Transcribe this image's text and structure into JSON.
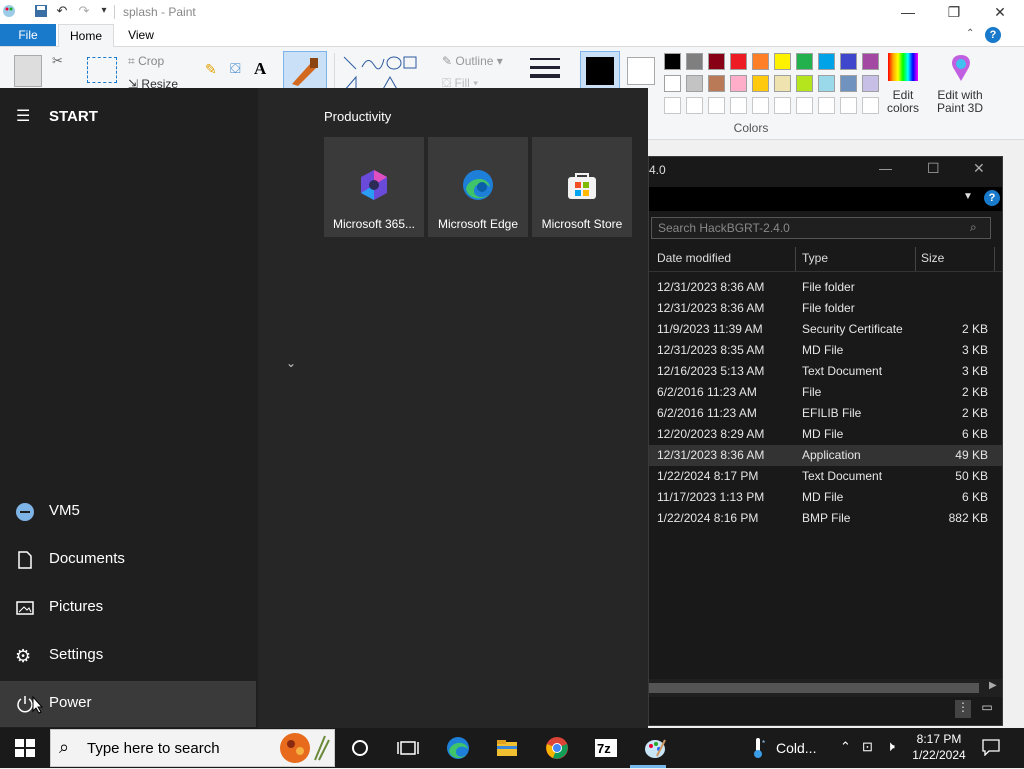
{
  "paint": {
    "title": "splash - Paint",
    "tabs": [
      "File",
      "Home",
      "View"
    ],
    "tools": {
      "crop": "Crop",
      "resize": "Resize",
      "outline": "Outline",
      "fill": "Fill",
      "text_tool": "A"
    },
    "colors_group_label": "Colors",
    "edit_colors": "Edit colors",
    "edit_with_3d": "Edit with Paint 3D",
    "palette_row1": [
      "#000000",
      "#7f7f7f",
      "#880015",
      "#ed1c24",
      "#ff7f27",
      "#fff200",
      "#22b14c",
      "#00a2e8",
      "#3f48cc",
      "#a349a4"
    ],
    "palette_row2": [
      "#ffffff",
      "#c3c3c3",
      "#b97a57",
      "#ffaec9",
      "#ffc90e",
      "#efe4b0",
      "#b5e61d",
      "#99d9ea",
      "#7092be",
      "#c8bfe7"
    ]
  },
  "explorer": {
    "title_fragment": "4.0",
    "search_placeholder": "Search HackBGRT-2.4.0",
    "columns": [
      "Date modified",
      "Type",
      "Size"
    ],
    "rows": [
      {
        "date": "12/31/2023 8:36 AM",
        "type": "File folder",
        "size": ""
      },
      {
        "date": "12/31/2023 8:36 AM",
        "type": "File folder",
        "size": ""
      },
      {
        "date": "11/9/2023 11:39 AM",
        "type": "Security Certificate",
        "size": "2 KB"
      },
      {
        "date": "12/31/2023 8:35 AM",
        "type": "MD File",
        "size": "3 KB"
      },
      {
        "date": "12/16/2023 5:13 AM",
        "type": "Text Document",
        "size": "3 KB"
      },
      {
        "date": "6/2/2016 11:23 AM",
        "type": "File",
        "size": "2 KB"
      },
      {
        "date": "6/2/2016 11:23 AM",
        "type": "EFILIB File",
        "size": "2 KB"
      },
      {
        "date": "12/20/2023 8:29 AM",
        "type": "MD File",
        "size": "6 KB"
      },
      {
        "date": "12/31/2023 8:36 AM",
        "type": "Application",
        "size": "49 KB"
      },
      {
        "date": "1/22/2024 8:17 PM",
        "type": "Text Document",
        "size": "50 KB"
      },
      {
        "date": "11/17/2023 1:13 PM",
        "type": "MD File",
        "size": "6 KB"
      },
      {
        "date": "1/22/2024 8:16 PM",
        "type": "BMP File",
        "size": "882 KB"
      }
    ],
    "selected_row": 8
  },
  "start": {
    "header": "START",
    "group_title": "Productivity",
    "tiles": [
      {
        "label": "Microsoft 365..."
      },
      {
        "label": "Microsoft Edge"
      },
      {
        "label": "Microsoft Store"
      }
    ],
    "nav": {
      "user": "VM5",
      "documents": "Documents",
      "pictures": "Pictures",
      "settings": "Settings",
      "power": "Power"
    }
  },
  "taskbar": {
    "search_placeholder": "Type here to search",
    "weather": "Cold...",
    "time": "8:17 PM",
    "date": "1/22/2024"
  },
  "colors": {
    "accent": "#1979ca",
    "start_bg": "#1f1f1f",
    "tile_bg": "#3a3a3a",
    "explorer_bg": "#191919"
  }
}
